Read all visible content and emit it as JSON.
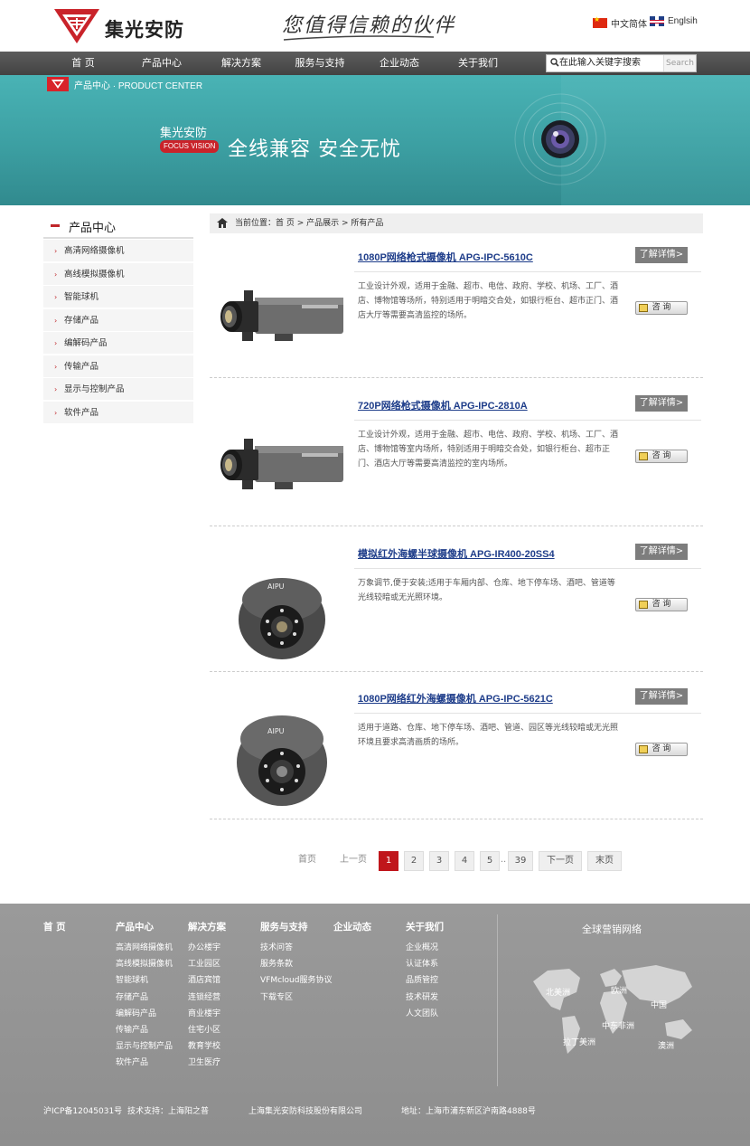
{
  "header": {
    "brand": "集光安防",
    "slogan": "您值得信赖的伙伴",
    "lang_cn": "中文简体",
    "lang_en": "Englsih"
  },
  "nav": {
    "items": [
      "首 页",
      "产品中心",
      "解决方案",
      "服务与支持",
      "企业动态",
      "关于我们"
    ]
  },
  "search": {
    "placeholder": "在此输入关键字搜索",
    "button": "Search"
  },
  "banner": {
    "section": "产品中心 · PRODUCT CENTER",
    "brand_cn": "集光安防",
    "brand_en": "FOCUS VISION",
    "tagline": "全线兼容  安全无忧"
  },
  "sidebar": {
    "title": "产品中心",
    "items": [
      "高清网络摄像机",
      "高线模拟摄像机",
      "智能球机",
      "存储产品",
      "编解码产品",
      "传输产品",
      "显示与控制产品",
      "软件产品"
    ]
  },
  "location": {
    "text": "当前位置：首 页 > 产品展示 > 所有产品"
  },
  "products": [
    {
      "title": "1080P网络枪式摄像机 APG-IPC-5610C",
      "desc": "工业设计外观，适用于金融、超市、电信、政府、学校、机场、工厂、酒店、博物馆等场所，特别适用于明暗交合处，如银行柜台、超市正门、酒店大厅等需要高清监控的场所。",
      "detail": "了解详情>",
      "ask": "咨 询"
    },
    {
      "title": "720P网络枪式摄像机 APG-IPC-2810A",
      "desc": "工业设计外观，适用于金融、超市、电信、政府、学校、机场、工厂、酒店、博物馆等室内场所，特别适用于明暗交合处，如银行柜台、超市正门、酒店大厅等需要高清监控的室内场所。",
      "detail": "了解详情>",
      "ask": "咨 询"
    },
    {
      "title": "模拟红外海螺半球摄像机 APG-IR400-20SS4",
      "desc": "万象调节,便于安装;适用于车厢内部、仓库、地下停车场、酒吧、管道等光线较暗或无光照环境。",
      "detail": "了解详情>",
      "ask": "咨 询"
    },
    {
      "title": "1080P网络红外海螺摄像机 APG-IPC-5621C",
      "desc": "适用于道路、仓库、地下停车场、酒吧、管道、园区等光线较暗或无光照环境且要求高清画质的场所。",
      "detail": "了解详情>",
      "ask": "咨 询"
    }
  ],
  "pagination": {
    "first": "首页",
    "prev": "上一页",
    "pages": [
      "1",
      "2",
      "3",
      "4",
      "5"
    ],
    "ellipsis": "..",
    "last_page": "39",
    "next": "下一页",
    "end": "末页",
    "current": "1"
  },
  "footer": {
    "columns": [
      {
        "title": "首 页",
        "items": []
      },
      {
        "title": "产品中心",
        "items": [
          "高清网络摄像机",
          "高线模拟摄像机",
          "智能球机",
          "存储产品",
          "编解码产品",
          "传输产品",
          "显示与控制产品",
          "软件产品"
        ]
      },
      {
        "title": "解决方案",
        "items": [
          "办公楼宇",
          "工业园区",
          "酒店宾馆",
          "连锁经营",
          "商业楼宇",
          "住宅小区",
          "教育学校",
          "卫生医疗"
        ]
      },
      {
        "title": "服务与支持",
        "items": [
          "技术问答",
          "服务条款",
          "VFMcloud服务协议",
          "下载专区"
        ]
      },
      {
        "title": "企业动态",
        "items": []
      },
      {
        "title": "关于我们",
        "items": [
          "企业概况",
          "认证体系",
          "品质管控",
          "技术研发",
          "人文团队"
        ]
      }
    ],
    "global": "全球营销网络",
    "map_labels": [
      "北美洲",
      "欧洲",
      "中国",
      "中东非洲",
      "拉丁美洲",
      "澳洲"
    ],
    "icp": "沪ICP备12045031号",
    "support": "技术支持：上海阳之普",
    "company": "上海集光安防科技股份有限公司",
    "address": "地址：上海市浦东新区沪南路4888号"
  },
  "colors": {
    "accent_red": "#c0151b",
    "nav_bg": "#4f4f4f",
    "banner_teal": "#3c9fa2",
    "link_blue": "#1e3d8a",
    "footer_bg": "#939393"
  }
}
